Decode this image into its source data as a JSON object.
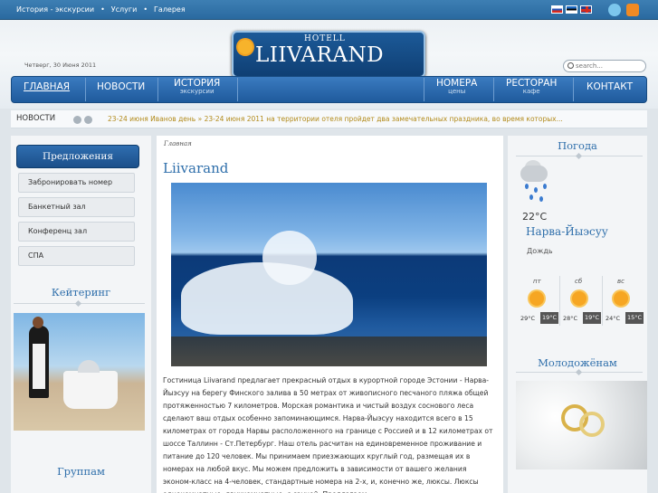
{
  "topbar": {
    "links": [
      "История - экскурсии",
      "Услуги",
      "Галерея"
    ],
    "separator": "•"
  },
  "header": {
    "date": "Четверг, 30 Июня 2011",
    "logo_hotel": "HOTELL",
    "logo_name": "LIIVARAND"
  },
  "search": {
    "placeholder": "search..."
  },
  "nav": {
    "home": "ГЛАВНАЯ",
    "news": "НОВОСТИ",
    "history": "ИСТОРИЯ",
    "history_sub": "экскурсии",
    "rooms": "НОМЕРА",
    "rooms_sub": "цены",
    "restaurant": "РЕСТОРАН",
    "restaurant_sub": "кафе",
    "contact": "КОНТАКТ"
  },
  "ticker": {
    "label": "НОВОСТИ",
    "text": "23-24 июня Иванов день » 23-24 июня 2011 на территории отеля пройдет  два замечательных праздника, во время которых..."
  },
  "sidebar": {
    "offers_title": "Предложения",
    "offers": [
      "Забронировать номер",
      "Банкетный зал",
      "Конференц зал",
      "СПА"
    ],
    "catering_title": "Кейтеринг",
    "groups_title": "Группам"
  },
  "main": {
    "breadcrumb": "Главная",
    "title": "Liivarand",
    "body": "Гостиница Liivarand предлагает прекрасный отдых в курортной городе Эстонии - Нарва-Йыэсуу на берегу Финского залива в 50 метрах от живописного песчаного пляжа общей протяженностью 7 километров. Морская романтика и чистый воздух соснового леса сделают ваш отдых особенно запоминающимся. Нарва-Йыэсуу находится всего в 15 километрах от города Нарвы расположенного на границе с Россией и в 12 километрах от шоссе Таллинн - Ст.Петербург. Наш отель расчитан на единовременное проживание и питание до 120 человек. Мы принимаем приезжающих круглый год, размещая их в номерах на любой вкус. Мы можем предложить в зависимости от вашего желания эконом-класс на 4-человек, стандартные номера на 2-х, и, конечно же, люксы. Люксы однокомнатные, двухкомнатные, с сауной. Предлагаем"
  },
  "weather": {
    "title": "Погода",
    "temp": "22°C",
    "city": "Нарва-Йыэсуу",
    "condition": "Дождь",
    "forecast": [
      {
        "day": "пт",
        "lo": "29°C",
        "hi": "19°C"
      },
      {
        "day": "сб",
        "lo": "28°C",
        "hi": "19°C"
      },
      {
        "day": "вс",
        "lo": "24°C",
        "hi": "15°C"
      }
    ]
  },
  "newlyweds": {
    "title": "Молодожёнам"
  },
  "colors": {
    "nav_blue": "#1f5a9c",
    "heading_blue": "#2f6fab",
    "ticker_gold": "#b28a1a"
  }
}
